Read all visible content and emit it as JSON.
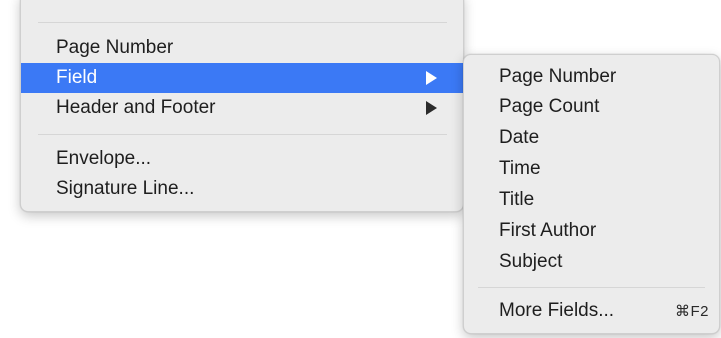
{
  "menu": {
    "items": [
      {
        "label": "Page Number"
      },
      {
        "label": "Field"
      },
      {
        "label": "Header and Footer"
      },
      {
        "label": "Envelope..."
      },
      {
        "label": "Signature Line..."
      }
    ],
    "selected": "Field"
  },
  "submenu": {
    "items": [
      {
        "label": "Page Number"
      },
      {
        "label": "Page Count"
      },
      {
        "label": "Date"
      },
      {
        "label": "Time"
      },
      {
        "label": "Title"
      },
      {
        "label": "First Author"
      },
      {
        "label": "Subject"
      }
    ],
    "more_fields": {
      "label": "More Fields...",
      "shortcut": "⌘F2"
    }
  },
  "colors": {
    "selection": "#3b79f5",
    "menu_background": "#ececec",
    "separator": "#d6d6d6"
  },
  "icons": [
    "submenu-arrow-icon",
    "submenu-arrow-icon"
  ]
}
